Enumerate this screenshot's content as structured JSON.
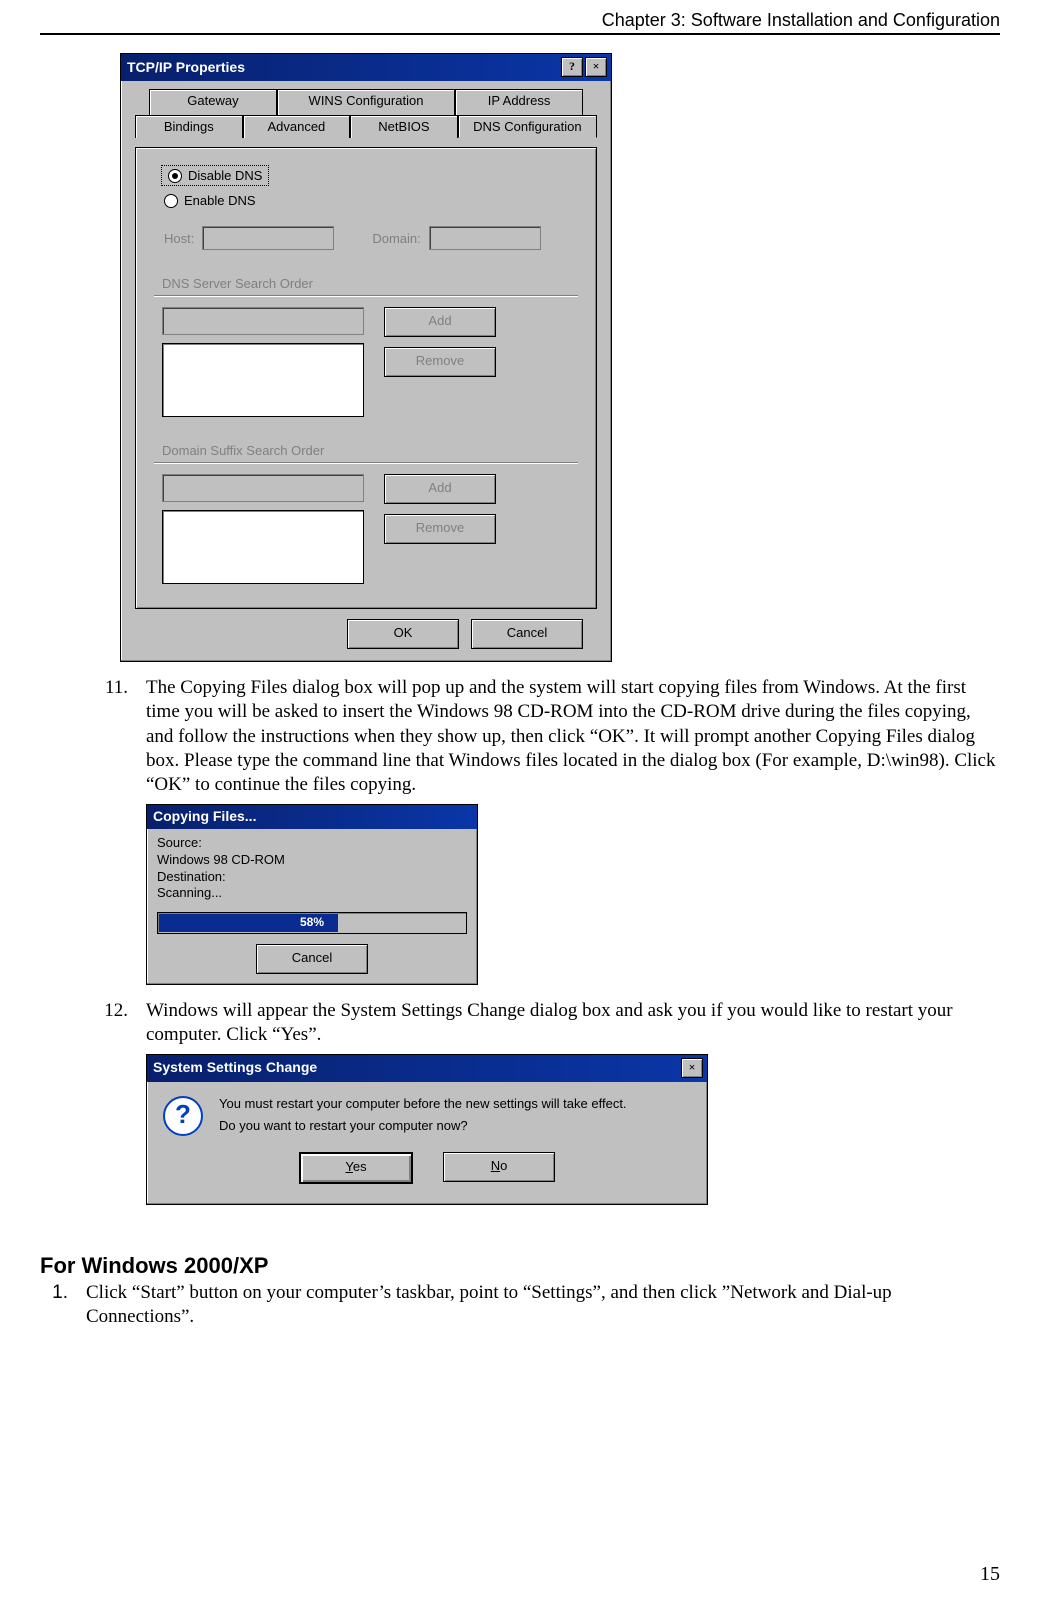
{
  "chapter_title": "Chapter 3: Software Installation and Configuration",
  "page_number": "15",
  "tcpip": {
    "title": "TCP/IP Properties",
    "help_btn": "?",
    "close_btn": "×",
    "tabs_row1": [
      "Gateway",
      "WINS Configuration",
      "IP Address"
    ],
    "tabs_row2": [
      "Bindings",
      "Advanced",
      "NetBIOS",
      "DNS Configuration"
    ],
    "disable_dns": "Disable DNS",
    "enable_dns": "Enable DNS",
    "host_label": "Host:",
    "domain_label": "Domain:",
    "dns_order": "DNS Server Search Order",
    "suffix_order": "Domain Suffix Search Order",
    "add": "Add",
    "remove": "Remove",
    "ok": "OK",
    "cancel": "Cancel"
  },
  "step11_num": "11.",
  "step11_text": "The Copying Files dialog box will pop up and the system will start copying files from Windows. At the first time you will be asked to insert the Windows 98 CD-ROM into the CD-ROM drive during the files copying, and follow the instructions when they show up, then click “OK”. It will prompt another Copying Files dialog box. Please type the command line that Windows files located in the dialog box (For example, D:\\win98). Click “OK” to continue the files copying.",
  "copying": {
    "title": "Copying Files...",
    "src_lbl": "Source:",
    "src_val": "Windows 98 CD-ROM",
    "dst_lbl": "Destination:",
    "dst_val": "Scanning...",
    "percent": "58%",
    "percent_num": 58,
    "cancel": "Cancel"
  },
  "step12_num": "12.",
  "step12_text": "Windows will appear the System Settings Change dialog box and ask you if you would like to restart your computer. Click “Yes”.",
  "ssc": {
    "title": "System Settings Change",
    "close": "×",
    "line1": "You must restart your computer before the new settings will take effect.",
    "line2": "Do you want to restart your computer now?",
    "yes": "Yes",
    "no": "No"
  },
  "section_heading": "For Windows 2000/XP",
  "w2k_step1_num": "1.",
  "w2k_step1_text": "Click “Start” button on your computer’s taskbar, point to “Settings”, and then click ”Network and Dial-up Connections”."
}
